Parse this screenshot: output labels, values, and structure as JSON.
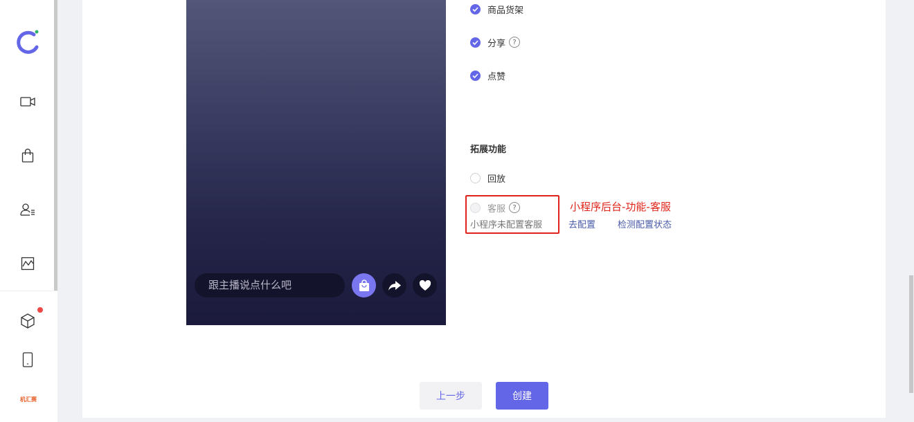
{
  "sidebar": {
    "icons": [
      "logo-icon",
      "video-icon",
      "shopping-bag-icon",
      "user-list-icon",
      "chart-icon",
      "package-icon",
      "mobile-icon"
    ],
    "brand": "机汇赛",
    "notification_color": "#f04848"
  },
  "preview": {
    "comment_placeholder": "跟主播说点什么吧",
    "buttons": [
      "shop-icon",
      "share-icon",
      "heart-icon"
    ]
  },
  "options": {
    "basic": [
      {
        "label": "商品货架",
        "checked": true,
        "help": false
      },
      {
        "label": "分享",
        "checked": true,
        "help": true
      },
      {
        "label": "点赞",
        "checked": true,
        "help": false
      }
    ],
    "ext_title": "拓展功能",
    "ext": [
      {
        "label": "回放",
        "checked": false,
        "disabled": false,
        "help": false
      },
      {
        "label": "客服",
        "checked": false,
        "disabled": true,
        "help": true
      }
    ],
    "ext_note": "小程序未配置客服",
    "link_configure": "去配置",
    "link_check": "检测配置状态",
    "annotation": "小程序后台-功能-客服",
    "help_glyph": "?"
  },
  "footer": {
    "prev_label": "上一步",
    "create_label": "创建"
  },
  "colors": {
    "accent": "#6466e8",
    "annotation": "#e0231a",
    "link": "#4a5ba8"
  }
}
